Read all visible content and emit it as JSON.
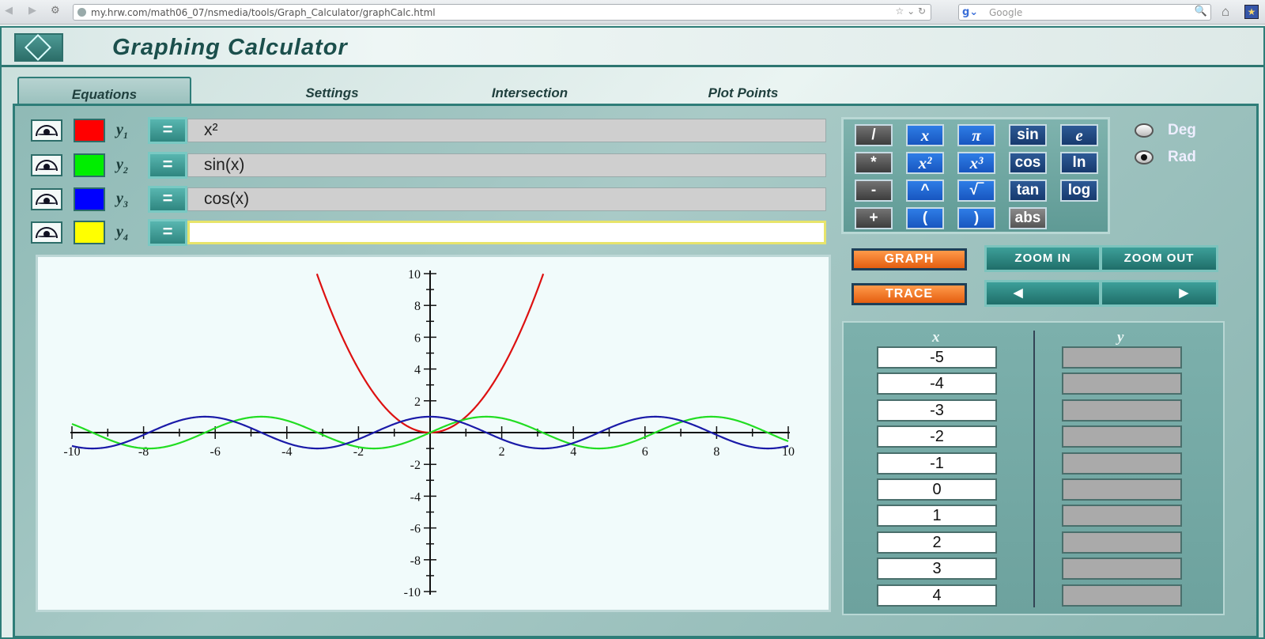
{
  "browser": {
    "url": "my.hrw.com/math06_07/nsmedia/tools/Graph_Calculator/graphCalc.html",
    "search_placeholder": "Google"
  },
  "app": {
    "title": "Graphing Calculator",
    "tabs": [
      "Equations",
      "Settings",
      "Intersection",
      "Plot Points"
    ],
    "active_tab": "Equations"
  },
  "equations": [
    {
      "label": "y",
      "sub": "1",
      "color": "#ff0000",
      "expr": "x²"
    },
    {
      "label": "y",
      "sub": "2",
      "color": "#00ee00",
      "expr": "sin(x)"
    },
    {
      "label": "y",
      "sub": "3",
      "color": "#0000ff",
      "expr": "cos(x)"
    },
    {
      "label": "y",
      "sub": "4",
      "color": "#ffff00",
      "expr": ""
    }
  ],
  "equals_label": "=",
  "keypad": {
    "rows": [
      [
        "/",
        "x",
        "π",
        "sin",
        "e"
      ],
      [
        "*",
        "x²",
        "x³",
        "cos",
        "ln"
      ],
      [
        "-",
        "^",
        "√‾",
        "tan",
        "log"
      ],
      [
        "+",
        "(",
        ")",
        "abs"
      ]
    ]
  },
  "angle_mode": {
    "options": [
      "Deg",
      "Rad"
    ],
    "selected": "Rad"
  },
  "buttons": {
    "graph": "GRAPH",
    "trace": "TRACE",
    "zoom_in": "ZOOM IN",
    "zoom_out": "ZOOM OUT",
    "left_arrow": "◀",
    "right_arrow": "▶"
  },
  "table": {
    "x_header": "x",
    "y_header": "y",
    "x_values": [
      "-5",
      "-4",
      "-3",
      "-2",
      "-1",
      "0",
      "1",
      "2",
      "3",
      "4"
    ]
  },
  "chart_data": {
    "type": "line",
    "xlim": [
      -10,
      10
    ],
    "ylim": [
      -10,
      10
    ],
    "x_ticks": [
      -10,
      -8,
      -6,
      -4,
      -2,
      2,
      4,
      6,
      8,
      10
    ],
    "y_ticks": [
      10,
      8,
      6,
      4,
      2,
      -2,
      -4,
      -6,
      -8,
      -10
    ],
    "series": [
      {
        "name": "x²",
        "color": "#dd1111",
        "function": "x^2"
      },
      {
        "name": "sin(x)",
        "color": "#22dd22",
        "function": "sin(x)"
      },
      {
        "name": "cos(x)",
        "color": "#1a1aa8",
        "function": "cos(x)"
      }
    ]
  }
}
